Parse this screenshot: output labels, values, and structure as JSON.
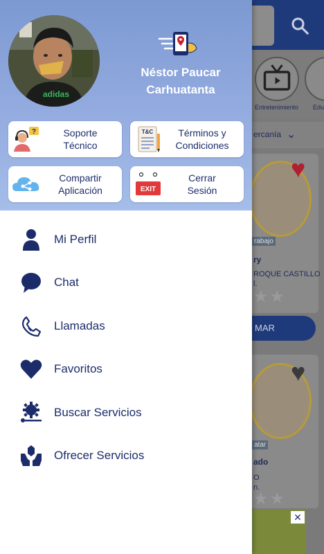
{
  "colors": {
    "accent": "#1c2c6b",
    "header_top": "#7c99d2",
    "header_bottom": "#a5bde9"
  },
  "drawer": {
    "user_name": "Néstor Paucar Carhuatanta",
    "header_buttons": {
      "support_label": "Soporte\nTécnico",
      "terms_label": "Términos y\nCondiciones",
      "share_label": "Compartir\nAplicación",
      "logout_label": "Cerrar\nSesión"
    },
    "icons": {
      "terms_badge": "T&C",
      "exit_badge": "EXIT"
    },
    "menu": [
      {
        "label": "Mi Perfil",
        "icon": "person-icon"
      },
      {
        "label": "Chat",
        "icon": "chat-bubble-icon"
      },
      {
        "label": "Llamadas",
        "icon": "phone-icon"
      },
      {
        "label": "Favoritos",
        "icon": "heart-icon"
      },
      {
        "label": "Buscar Servicios",
        "icon": "gear-icon"
      },
      {
        "label": "Ofrecer Servicios",
        "icon": "hands-icon"
      }
    ]
  },
  "background": {
    "categories": [
      "Entretenimiento",
      "Edu"
    ],
    "filter_label": "ercanía",
    "card1": {
      "tag": "rabajo",
      "name": "ry",
      "subtitle": "ROQUE CASTILLO",
      "extra": "l.",
      "button": "MAR"
    },
    "card2": {
      "tag": "atar",
      "name": "ado",
      "subtitle": "O",
      "extra": "n."
    }
  }
}
